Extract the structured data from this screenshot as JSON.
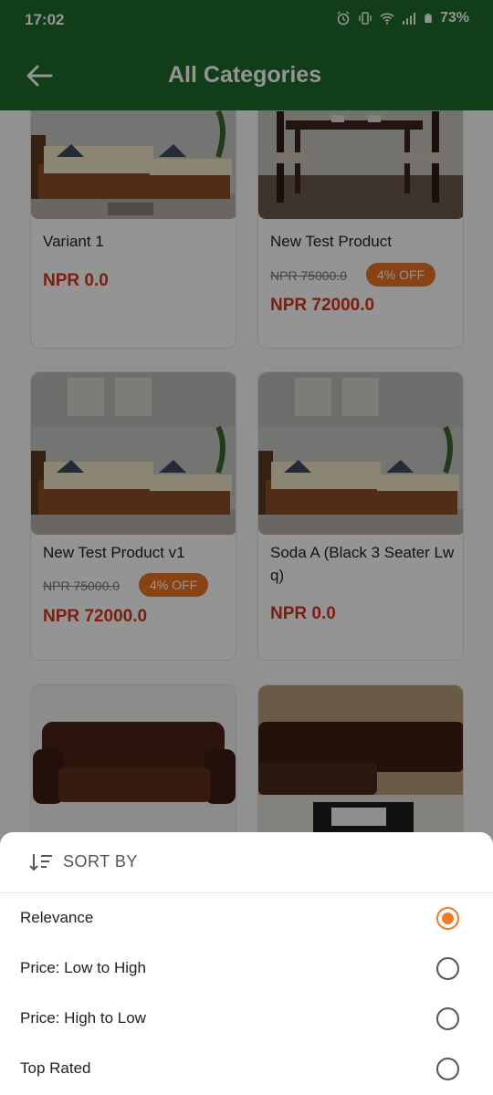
{
  "status_bar": {
    "time": "17:02",
    "battery": "73%"
  },
  "app_bar": {
    "title": "All Categories"
  },
  "products": [
    {
      "name": "Variant 1",
      "original_price": "",
      "discount": "",
      "price": "NPR 0.0",
      "image": "sofa-beige"
    },
    {
      "name": "New Test Product",
      "original_price": "NPR 75000.0",
      "discount": "4% OFF",
      "price": "NPR 72000.0",
      "image": "dining-set"
    },
    {
      "name": "New Test Product v1",
      "original_price": "NPR 75000.0",
      "discount": "4% OFF",
      "price": "NPR 72000.0",
      "image": "sofa-beige"
    },
    {
      "name": "Soda A (Black 3 Seater Lw q)",
      "original_price": "",
      "discount": "",
      "price": "NPR 0.0",
      "image": "sofa-beige"
    },
    {
      "name": "",
      "original_price": "",
      "discount": "",
      "price": "",
      "image": "leather-sofa"
    },
    {
      "name": "",
      "original_price": "",
      "discount": "",
      "price": "",
      "image": "sectional-sofa"
    }
  ],
  "sort_sheet": {
    "title": "SORT BY",
    "options": [
      {
        "label": "Relevance",
        "selected": true
      },
      {
        "label": "Price: Low to High",
        "selected": false
      },
      {
        "label": "Price: High to Low",
        "selected": false
      },
      {
        "label": "Top Rated",
        "selected": false
      }
    ]
  },
  "colors": {
    "primary": "#1f6a2b",
    "accent": "#ef7b27",
    "price": "#d5361c",
    "discount_badge": "#ea7424"
  }
}
